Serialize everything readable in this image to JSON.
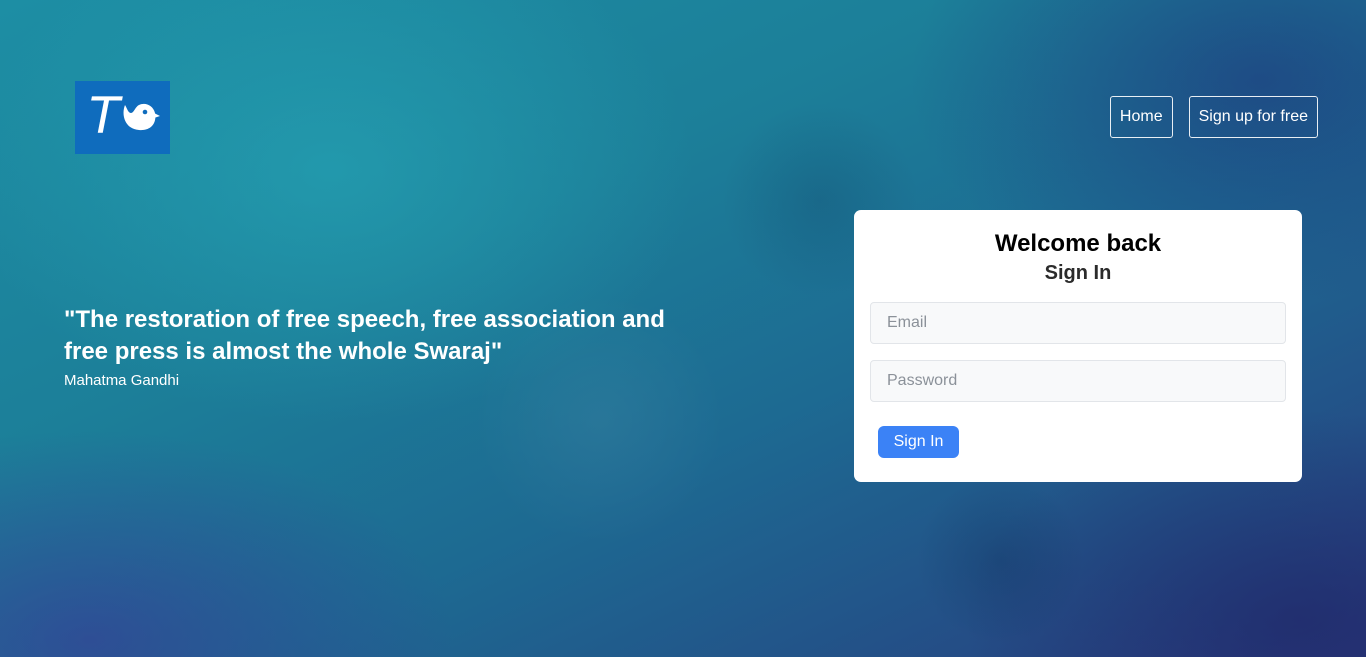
{
  "brand": {
    "logo_letter": "T",
    "logo_color": "#0f6cbd"
  },
  "nav": {
    "home_label": "Home",
    "signup_label": "Sign up for free"
  },
  "quote": {
    "text": "\"The restoration of free speech, free association and free press is almost the whole Swaraj\"",
    "author": "Mahatma Gandhi"
  },
  "login": {
    "title": "Welcome back",
    "subtitle": "Sign In",
    "email": {
      "placeholder": "Email",
      "value": ""
    },
    "password": {
      "placeholder": "Password",
      "value": ""
    },
    "submit_label": "Sign In"
  },
  "colors": {
    "primary_button": "#3b82f6",
    "card_background": "#ffffff",
    "input_background": "#f8f9fa"
  },
  "icons": {
    "logo_icon": "bird-icon"
  }
}
